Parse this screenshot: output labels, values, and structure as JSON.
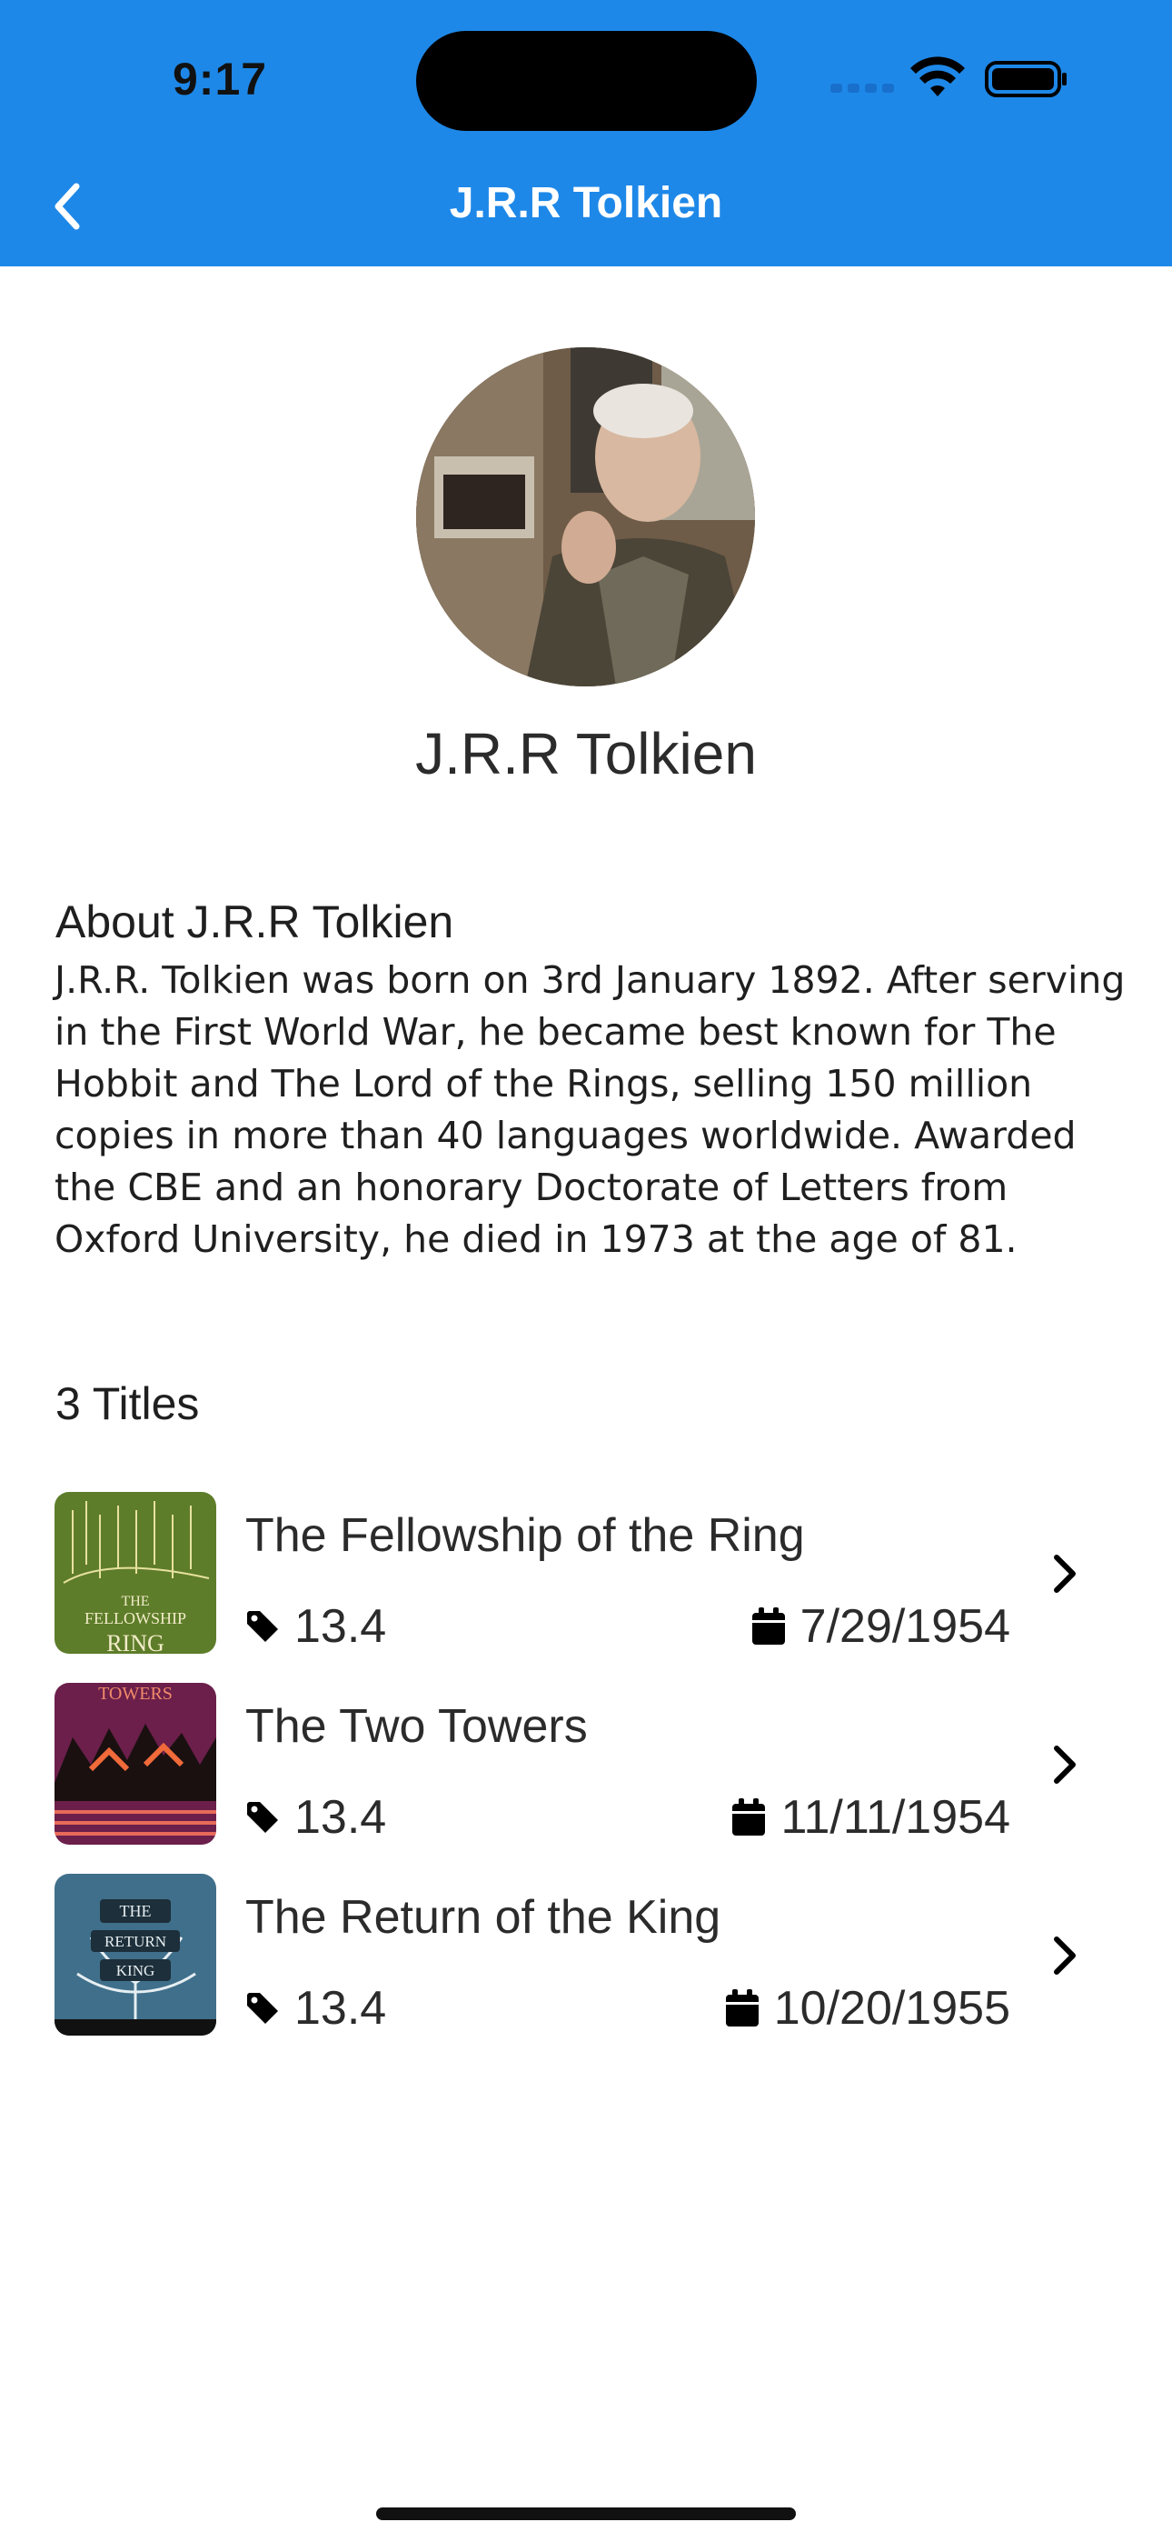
{
  "status_bar": {
    "time": "9:17"
  },
  "header": {
    "title": "J.R.R Tolkien"
  },
  "author": {
    "name": "J.R.R Tolkien"
  },
  "about": {
    "heading": "About J.R.R Tolkien",
    "text": "J.R.R. Tolkien was born on 3rd January 1892. After serving in the First World War, he became best known for The Hobbit and The Lord of the Rings, selling 150 million copies in more than 40 languages worldwide. Awarded the CBE and an honorary Doctorate of Letters from Oxford University, he died in 1973 at the age of 81."
  },
  "titles": {
    "count_label": "3 Titles",
    "items": [
      {
        "title": "The Fellowship of the Ring",
        "rating": "13.4",
        "date": "7/29/1954",
        "cover_color": "#5e7d2a"
      },
      {
        "title": "The Two Towers",
        "rating": "13.4",
        "date": "11/11/1954",
        "cover_color": "#6b1f4a"
      },
      {
        "title": "The Return of the King",
        "rating": "13.4",
        "date": "10/20/1955",
        "cover_color": "#3f6f8a"
      }
    ]
  },
  "colors": {
    "accent": "#1e88e8"
  },
  "icons": {
    "back": "chevron-left-icon",
    "rating": "tag-icon",
    "date": "calendar-icon",
    "row_arrow": "chevron-right-icon"
  }
}
